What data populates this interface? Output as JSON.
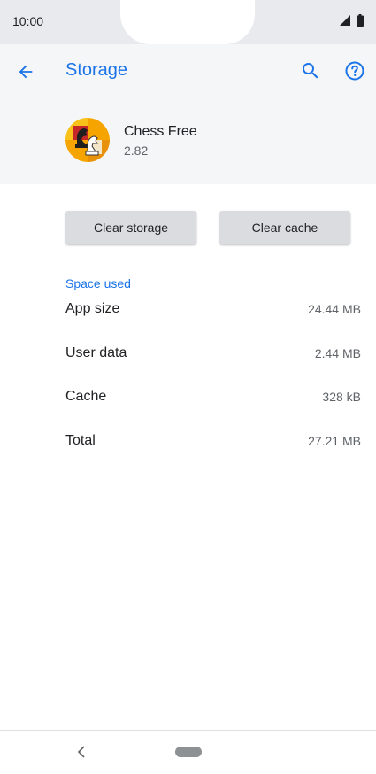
{
  "status_bar": {
    "time": "10:00"
  },
  "header": {
    "title": "Storage"
  },
  "app": {
    "name": "Chess Free",
    "version": "2.82"
  },
  "actions": {
    "clear_storage": "Clear storage",
    "clear_cache": "Clear cache"
  },
  "space_used": {
    "header": "Space used",
    "rows": [
      {
        "label": "App size",
        "value": "24.44 MB"
      },
      {
        "label": "User data",
        "value": "2.44 MB"
      },
      {
        "label": "Cache",
        "value": "328 kB"
      },
      {
        "label": "Total",
        "value": "27.21 MB"
      }
    ]
  },
  "colors": {
    "accent": "#1a73e8",
    "button": "#dadcdf",
    "header_bg": "#f5f6f7"
  },
  "icons": [
    "back-arrow-icon",
    "search-icon",
    "help-icon",
    "signal-icon",
    "battery-icon",
    "nav-back-icon"
  ]
}
